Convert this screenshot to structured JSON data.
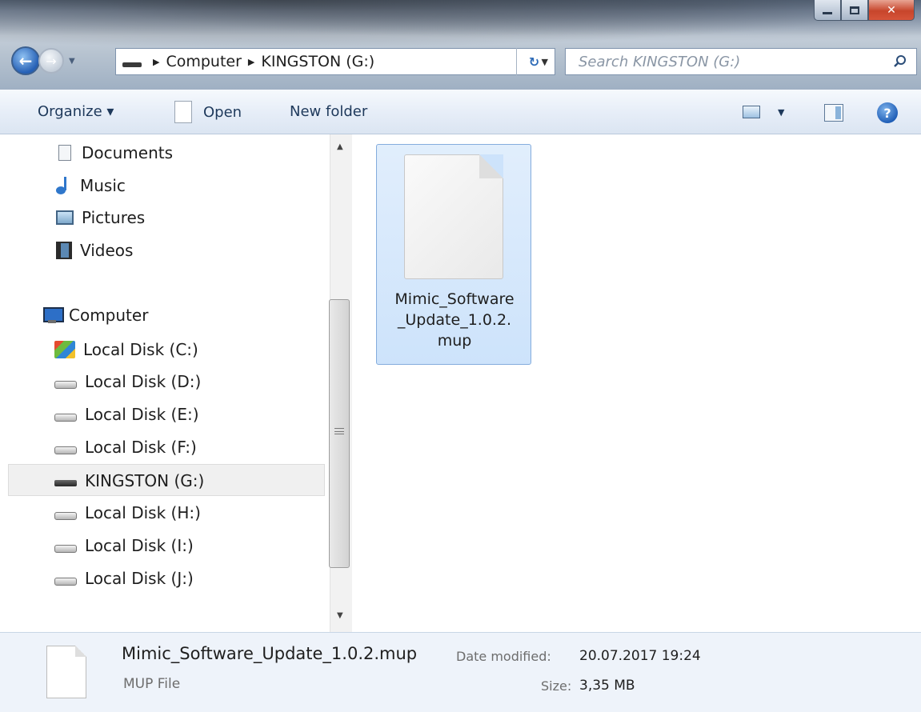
{
  "address": {
    "crumbs": [
      "Computer",
      "KINGSTON (G:)"
    ],
    "search_placeholder": "Search KINGSTON (G:)"
  },
  "toolbar": {
    "organize_label": "Organize ▾",
    "open_label": "Open",
    "new_folder_label": "New folder"
  },
  "navigation": {
    "libraries": [
      {
        "label": "Documents",
        "icon": "documents-icon"
      },
      {
        "label": "Music",
        "icon": "music-icon"
      },
      {
        "label": "Pictures",
        "icon": "pictures-icon"
      },
      {
        "label": "Videos",
        "icon": "videos-icon"
      }
    ],
    "computer_label": "Computer",
    "drives": [
      {
        "label": "Local Disk (C:)",
        "icon": "windows-drive-icon"
      },
      {
        "label": "Local Disk (D:)",
        "icon": "hard-disk-icon"
      },
      {
        "label": "Local Disk (E:)",
        "icon": "hard-disk-icon"
      },
      {
        "label": "Local Disk (F:)",
        "icon": "hard-disk-icon"
      },
      {
        "label": "KINGSTON (G:)",
        "icon": "usb-drive-icon",
        "selected": true
      },
      {
        "label": "Local Disk (H:)",
        "icon": "hard-disk-icon"
      },
      {
        "label": "Local Disk (I:)",
        "icon": "hard-disk-icon"
      },
      {
        "label": "Local Disk (J:)",
        "icon": "hard-disk-icon"
      }
    ]
  },
  "content": {
    "files": [
      {
        "name_lines": [
          "Mimic_Software",
          "_Update_1.0.2.",
          "mup"
        ],
        "selected": true
      }
    ]
  },
  "details": {
    "file_name": "Mimic_Software_Update_1.0.2.mup",
    "file_type": "MUP File",
    "date_label": "Date modified:",
    "date_value": "20.07.2017 19:24",
    "size_label": "Size:",
    "size_value": "3,35 MB"
  },
  "colors": {
    "selection": "#cde3fb",
    "selection_border": "#84acdd",
    "toolbar_text": "#1e395b",
    "details_bg": "#eef3fa"
  }
}
